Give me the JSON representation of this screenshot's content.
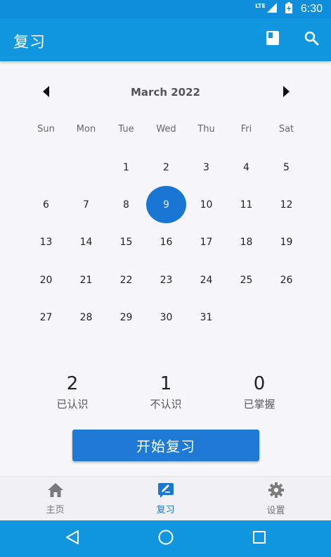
{
  "status_bar": {
    "network": "LTE",
    "time": "6:30"
  },
  "app_bar": {
    "title": "复习",
    "actions": [
      {
        "icon": "book-icon"
      },
      {
        "icon": "search-icon"
      }
    ]
  },
  "calendar": {
    "month_label": "March 2022",
    "weekdays": [
      "Sun",
      "Mon",
      "Tue",
      "Wed",
      "Thu",
      "Fri",
      "Sat"
    ],
    "days": [
      "",
      "",
      "1",
      "2",
      "3",
      "4",
      "5",
      "6",
      "7",
      "8",
      "9",
      "10",
      "11",
      "12",
      "13",
      "14",
      "15",
      "16",
      "17",
      "18",
      "19",
      "20",
      "21",
      "22",
      "23",
      "24",
      "25",
      "26",
      "27",
      "28",
      "29",
      "30",
      "31",
      "",
      ""
    ],
    "selected_day": "9",
    "accent_color": "#1976d2"
  },
  "stats": [
    {
      "value": "2",
      "label": "已认识"
    },
    {
      "value": "1",
      "label": "不认识"
    },
    {
      "value": "0",
      "label": "已掌握"
    }
  ],
  "start_button": {
    "label": "开始复习"
  },
  "bottom_nav": [
    {
      "label": "主页",
      "icon": "home-icon",
      "active": false
    },
    {
      "label": "复习",
      "icon": "review-icon",
      "active": true
    },
    {
      "label": "设置",
      "icon": "gear-icon",
      "active": false
    }
  ],
  "system_nav": [
    "back-icon",
    "home-circle-icon",
    "recents-icon"
  ],
  "colors": {
    "primary": "#1196e0",
    "accent": "#1976d2",
    "inactive": "#777777"
  }
}
